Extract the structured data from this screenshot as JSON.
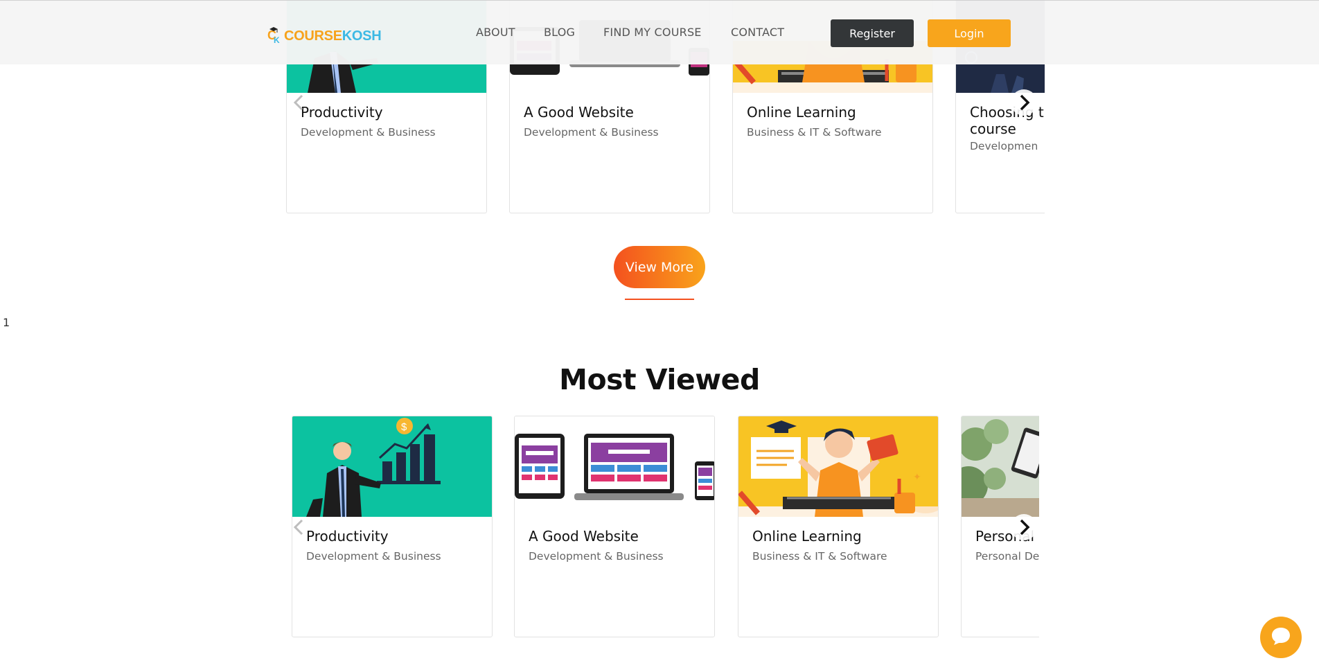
{
  "header": {
    "logo": {
      "text_a": "COURSE",
      "text_b": "KOSH"
    },
    "nav": [
      "ABOUT",
      "BLOG",
      "FIND MY COURSE",
      "CONTACT"
    ],
    "register_label": "Register",
    "login_label": "Login"
  },
  "top_carousel": {
    "cards": [
      {
        "title": "Productivity",
        "category": "Development & Business",
        "image": "productivity-illustration"
      },
      {
        "title": "A Good Website",
        "category": "Development & Business",
        "image": "website-devices-illustration"
      },
      {
        "title": "Online Learning",
        "category": "Business & IT & Software",
        "image": "online-learning-illustration"
      },
      {
        "title": "Choosing the right course",
        "title_visible": "Choosing t",
        "title_line2": "course",
        "category": "Developmen",
        "image": "dark-photo"
      }
    ]
  },
  "view_more_label": "View More",
  "stray_text": "1",
  "most_viewed": {
    "title": "Most Viewed",
    "cards": [
      {
        "title": "Productivity",
        "category": "Development & Business",
        "image": "productivity-illustration"
      },
      {
        "title": "A Good Website",
        "category": "Development & Business",
        "image": "website-devices-illustration"
      },
      {
        "title": "Online Learning",
        "category": "Business & IT & Software",
        "image": "online-learning-illustration"
      },
      {
        "title": "Personal",
        "category": "Personal De",
        "image": "tablet-photo"
      }
    ]
  },
  "icons": {
    "prev": "chevron-left-icon",
    "next": "chevron-right-icon",
    "chat": "chat-bubble-icon"
  },
  "colors": {
    "accent": "#f8a51c",
    "dark_button": "#333638",
    "gradient_start": "#f4511e",
    "gradient_end": "#f9a31b",
    "teal": "#0cc2a0"
  }
}
